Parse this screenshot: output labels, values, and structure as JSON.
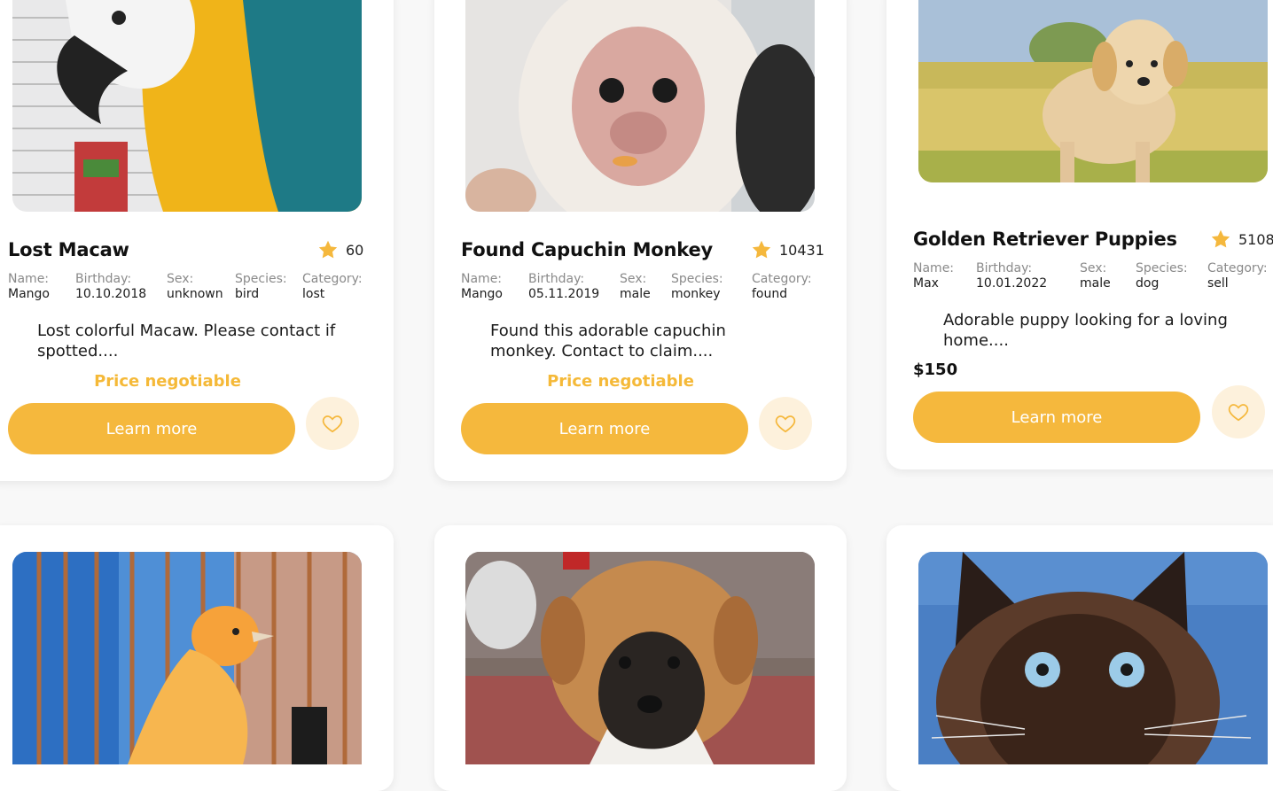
{
  "listings": [
    {
      "title": "Lost Macaw",
      "rating": "60",
      "fields": [
        {
          "label": "Name:",
          "value": "Mango"
        },
        {
          "label": "Birthday:",
          "value": "10.10.2018"
        },
        {
          "label": "Sex:",
          "value": "unknown"
        },
        {
          "label": "Species:",
          "value": "bird"
        },
        {
          "label": "Category:",
          "value": "lost"
        }
      ],
      "description": "Lost colorful Macaw. Please contact if spotted....",
      "price": "Price negotiable",
      "button": "Learn more",
      "image": "macaw-photo"
    },
    {
      "title": "Found Capuchin Monkey",
      "rating": "10431",
      "fields": [
        {
          "label": "Name:",
          "value": "Mango"
        },
        {
          "label": "Birthday:",
          "value": "05.11.2019"
        },
        {
          "label": "Sex:",
          "value": "male"
        },
        {
          "label": "Species:",
          "value": "monkey"
        },
        {
          "label": "Category:",
          "value": "found"
        }
      ],
      "description": "Found this adorable capuchin monkey. Contact to claim....",
      "price": "Price negotiable",
      "button": "Learn more",
      "image": "capuchin-photo"
    },
    {
      "title": "Golden Retriever Puppies",
      "rating": "5108",
      "fields": [
        {
          "label": "Name:",
          "value": "Max"
        },
        {
          "label": "Birthday:",
          "value": "10.01.2022"
        },
        {
          "label": "Sex:",
          "value": "male"
        },
        {
          "label": "Species:",
          "value": "dog"
        },
        {
          "label": "Category:",
          "value": "sell"
        }
      ],
      "description": "Adorable puppy looking for a loving home....",
      "price": "$150",
      "button": "Learn more",
      "image": "golden-retriever-photo"
    }
  ],
  "second_row_images": [
    "canary-photo",
    "puppy-photo",
    "siamese-cat-photo"
  ],
  "icons": {
    "rating": "star-icon",
    "favorite": "heart-outline-icon"
  },
  "colors": {
    "accent": "#f5b83d",
    "price_negotiable": "#f5b938",
    "fav_bg": "#fdf1dc",
    "background": "#f8f8f8"
  }
}
